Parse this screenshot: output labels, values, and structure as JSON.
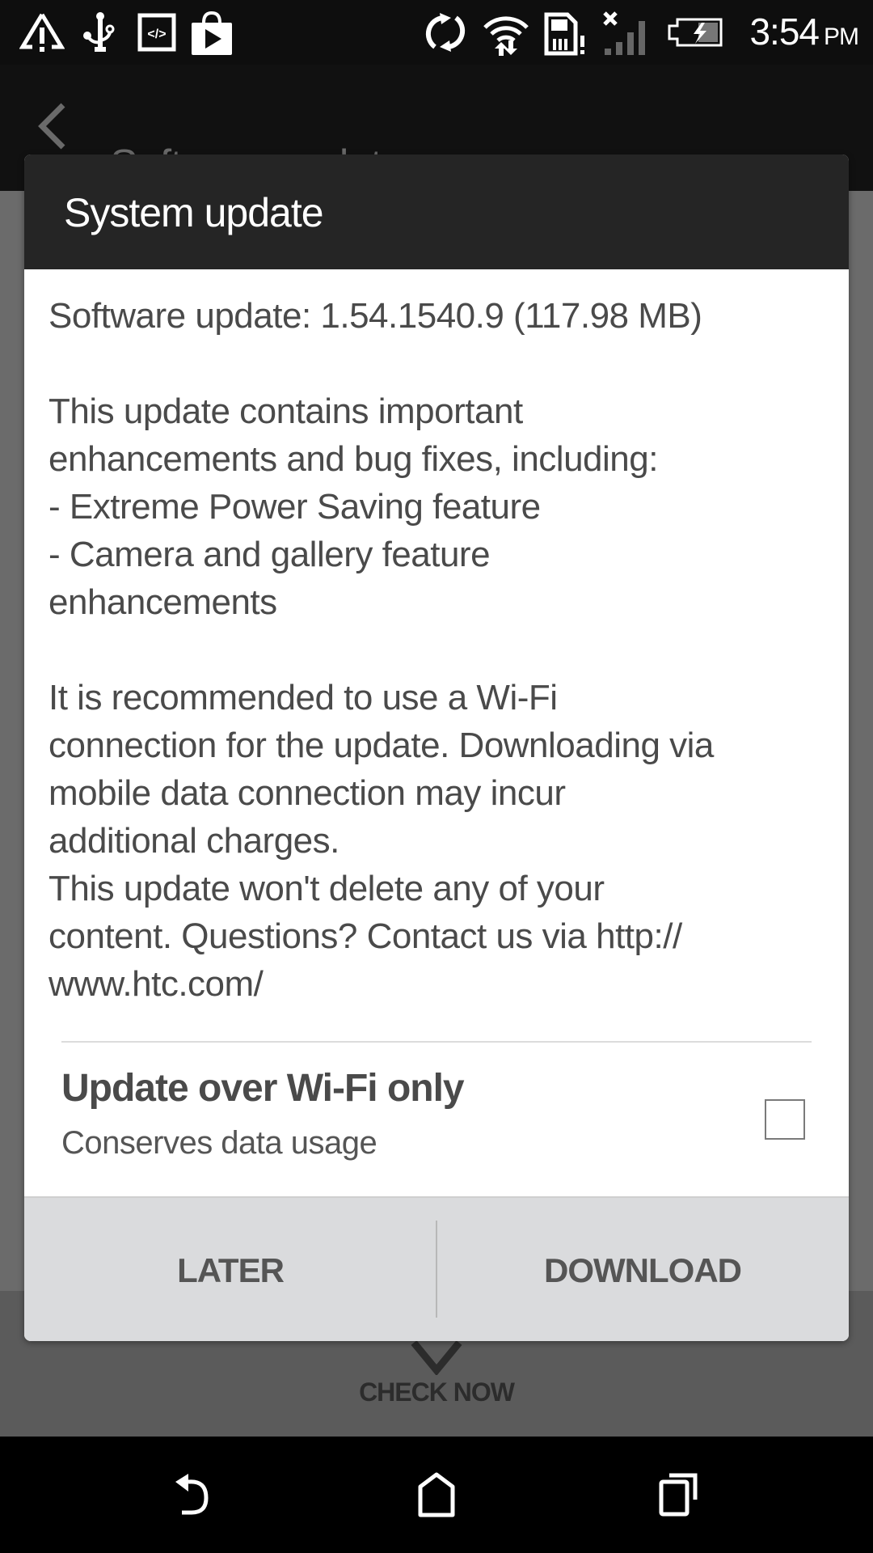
{
  "status_bar": {
    "time": "3:54",
    "ampm": "PM",
    "left_icons": [
      "warning-icon",
      "usb-icon",
      "developer-code-icon",
      "play-store-icon"
    ],
    "right_icons": [
      "sync-icon",
      "wifi-data-icon",
      "sd-card-alert-icon",
      "no-signal-icon",
      "battery-charging-icon"
    ]
  },
  "app_bar": {
    "back_icon": "chevron-left-icon",
    "title": "Software updates"
  },
  "background": {
    "check_now_label": "CHECK NOW"
  },
  "dialog": {
    "title": "System update",
    "update_line": "Software update: 1.54.1540.9 (117.98 MB)",
    "description_lines": [
      "This update contains important",
      "enhancements and bug fixes, including:",
      "- Extreme Power Saving feature",
      "- Camera and gallery feature",
      "enhancements"
    ],
    "notice_lines": [
      "It is recommended to use a Wi-Fi",
      "connection for the update. Downloading via",
      "mobile data connection may incur",
      "additional charges.",
      "This update won't delete any of your",
      "content. Questions? Contact us via http://",
      "www.htc.com/"
    ],
    "option": {
      "title": "Update over Wi-Fi only",
      "subtitle": "Conserves data usage",
      "checked": false
    },
    "buttons": {
      "later": "LATER",
      "download": "DOWNLOAD"
    }
  },
  "nav_bar": {
    "back": "back-icon",
    "home": "home-icon",
    "recents": "recents-icon"
  }
}
